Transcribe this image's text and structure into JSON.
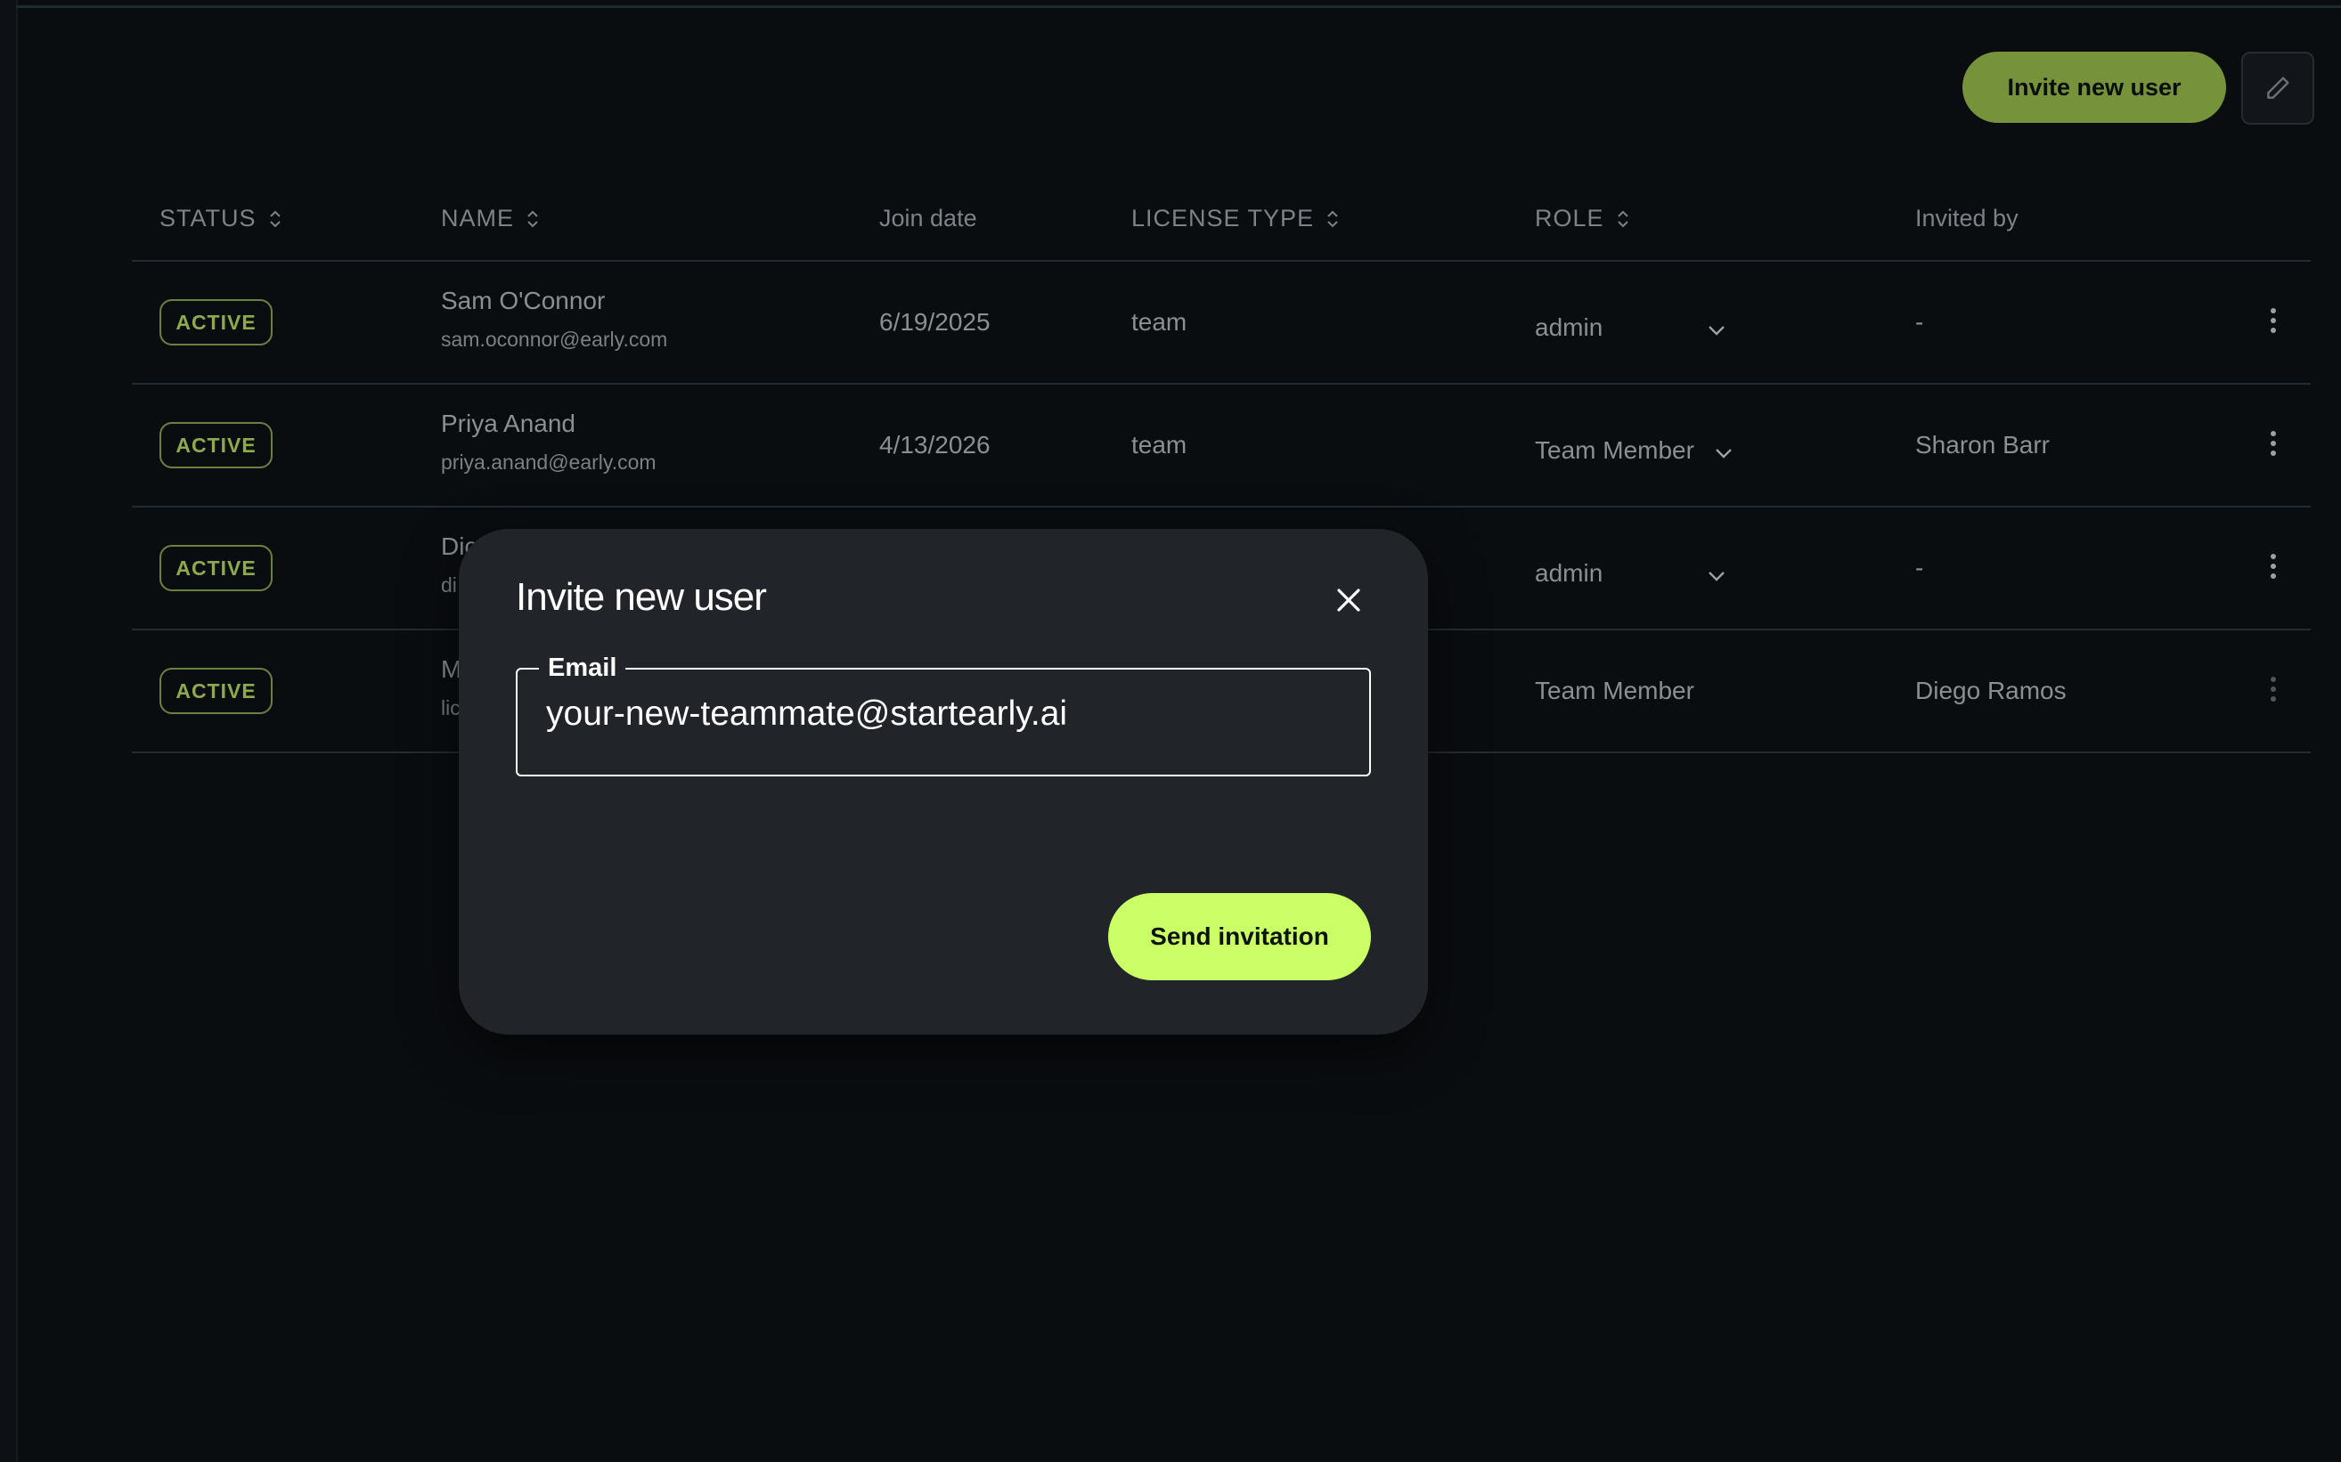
{
  "toolbar": {
    "invite_label": "Invite new user",
    "edit_icon": "pencil-icon"
  },
  "table": {
    "headers": {
      "status": "STATUS",
      "name": "NAME",
      "join_date": "Join date",
      "license_type": "LICENSE TYPE",
      "role": "ROLE",
      "invited_by": "Invited by"
    },
    "rows": [
      {
        "status": "ACTIVE",
        "name": "Sam O'Connor",
        "email": "sam.oconnor@early.com",
        "join_date": "6/19/2025",
        "license": "team",
        "role": "admin",
        "invited_by": "-"
      },
      {
        "status": "ACTIVE",
        "name": "Priya Anand",
        "email": "priya.anand@early.com",
        "join_date": "4/13/2026",
        "license": "team",
        "role": "Team Member",
        "invited_by": "Sharon Barr"
      },
      {
        "status": "ACTIVE",
        "name": "Dic",
        "email": "di",
        "join_date": "",
        "license": "",
        "role": "admin",
        "invited_by": "-"
      },
      {
        "status": "ACTIVE",
        "name": "M",
        "email": "lic",
        "join_date": "",
        "license": "",
        "role": "Team Member",
        "invited_by": "Diego Ramos"
      }
    ]
  },
  "modal": {
    "title": "Invite new user",
    "email_label": "Email",
    "email_value": "your-new-teammate@startearly.ai",
    "send_label": "Send invitation"
  },
  "colors": {
    "background": "#0a0d10",
    "accent": "#caff66",
    "accent_muted": "#7c9a3e",
    "modal_bg": "#212429"
  }
}
